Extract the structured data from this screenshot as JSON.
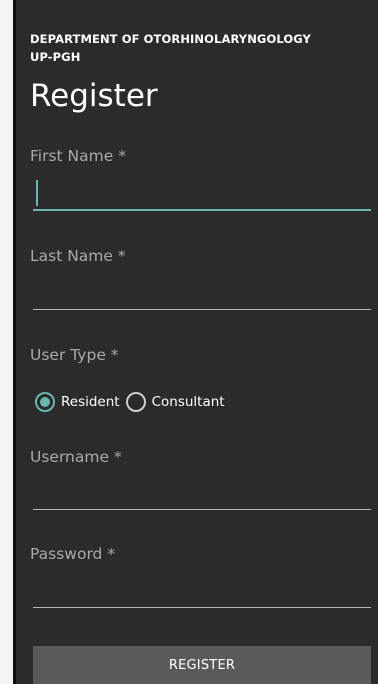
{
  "header": {
    "department_line1": "DEPARTMENT OF OTORHINOLARYNGOLOGY",
    "department_line2": "UP-PGH",
    "title": "Register"
  },
  "form": {
    "first_name": {
      "label": "First Name *",
      "value": ""
    },
    "last_name": {
      "label": "Last Name *",
      "value": ""
    },
    "user_type": {
      "label": "User Type *",
      "options": [
        "Resident",
        "Consultant"
      ],
      "selected": "Resident"
    },
    "username": {
      "label": "Username *",
      "value": ""
    },
    "password": {
      "label": "Password *",
      "value": ""
    },
    "submit_label": "REGISTER"
  },
  "colors": {
    "background": "#2b2b2b",
    "accent": "#6ab5ac",
    "label": "#a9a9a9",
    "button": "#5a5a5a"
  }
}
